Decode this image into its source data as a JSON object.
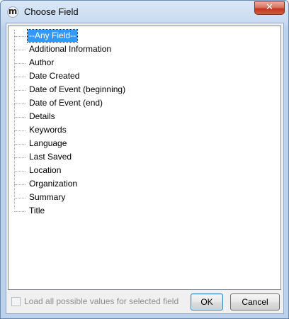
{
  "window": {
    "title": "Choose Field",
    "app_icon_letter": "m",
    "close_glyph": "✕"
  },
  "tree": {
    "selected_index": 0,
    "items": [
      {
        "label": "--Any Field--"
      },
      {
        "label": "Additional Information"
      },
      {
        "label": "Author"
      },
      {
        "label": "Date Created"
      },
      {
        "label": "Date of Event (beginning)"
      },
      {
        "label": "Date of Event (end)"
      },
      {
        "label": "Details"
      },
      {
        "label": "Keywords"
      },
      {
        "label": "Language"
      },
      {
        "label": "Last Saved"
      },
      {
        "label": "Location"
      },
      {
        "label": "Organization"
      },
      {
        "label": "Summary"
      },
      {
        "label": "Title"
      }
    ]
  },
  "options": {
    "load_all_label": "Load all possible values for selected field",
    "load_all_checked": false,
    "load_all_enabled": false
  },
  "buttons": {
    "ok_label": "OK",
    "cancel_label": "Cancel"
  },
  "colors": {
    "selection": "#3399ff",
    "close_button": "#c2371e"
  }
}
